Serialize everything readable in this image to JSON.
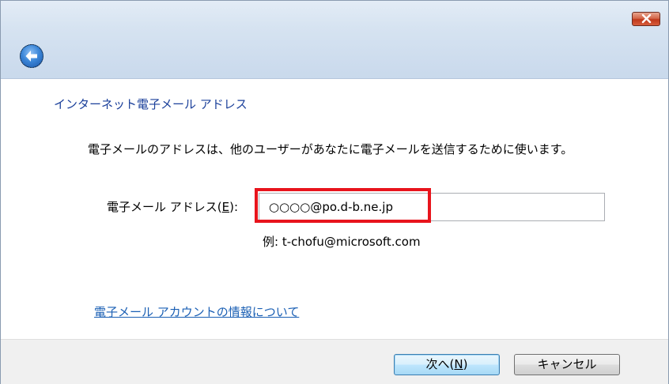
{
  "dialog": {
    "heading": "インターネット電子メール アドレス",
    "description": "電子メールのアドレスは、他のユーザーがあなたに電子メールを送信するために使います。",
    "email_label_prefix": "電子メール アドレス(",
    "email_label_accel": "E",
    "email_label_suffix": "):",
    "email_value": "○○○○@po.d-b.ne.jp",
    "example_text": "例: t-chofu@microsoft.com",
    "info_link": "電子メール アカウントの情報について"
  },
  "buttons": {
    "next_prefix": "次へ(",
    "next_accel": "N",
    "next_suffix": ")",
    "cancel_label": "キャンセル"
  },
  "icons": {
    "close": "close-icon",
    "back": "back-arrow-icon"
  },
  "colors": {
    "heading": "#1a3f9a",
    "link": "#1a5fb4",
    "highlight": "#e8141c",
    "close_button": "#c0391b"
  }
}
